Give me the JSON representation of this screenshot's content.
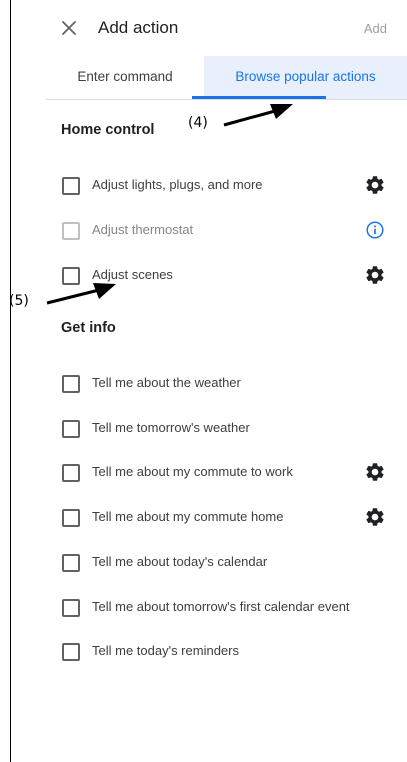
{
  "header": {
    "title": "Add action",
    "add_label": "Add"
  },
  "tabs": [
    {
      "label": "Enter command",
      "selected": false
    },
    {
      "label": "Browse popular actions",
      "selected": true
    }
  ],
  "sections": [
    {
      "title": "Home control",
      "items": [
        {
          "label": "Adjust lights, plugs, and more",
          "icon": "gear-icon",
          "disabled": false
        },
        {
          "label": "Adjust thermostat",
          "icon": "info-icon",
          "disabled": true
        },
        {
          "label": "Adjust scenes",
          "icon": "gear-icon",
          "disabled": false
        }
      ]
    },
    {
      "title": "Get info",
      "items": [
        {
          "label": "Tell me about the weather",
          "icon": null,
          "disabled": false
        },
        {
          "label": "Tell me tomorrow's weather",
          "icon": null,
          "disabled": false
        },
        {
          "label": "Tell me about my commute to work",
          "icon": "gear-icon",
          "disabled": false
        },
        {
          "label": "Tell me about my commute home",
          "icon": "gear-icon",
          "disabled": false
        },
        {
          "label": "Tell me about today's calendar",
          "icon": null,
          "disabled": false
        },
        {
          "label": "Tell me about tomorrow's first calendar event",
          "icon": null,
          "disabled": false
        },
        {
          "label": "Tell me today's reminders",
          "icon": null,
          "disabled": false
        }
      ]
    }
  ],
  "annotations": {
    "label_4": "(4)",
    "label_5": "(5)"
  },
  "colors": {
    "accent": "#1a73e8",
    "tab_selected_bg": "#e8f0fe",
    "text": "#202124",
    "muted": "#9aa0a6"
  }
}
